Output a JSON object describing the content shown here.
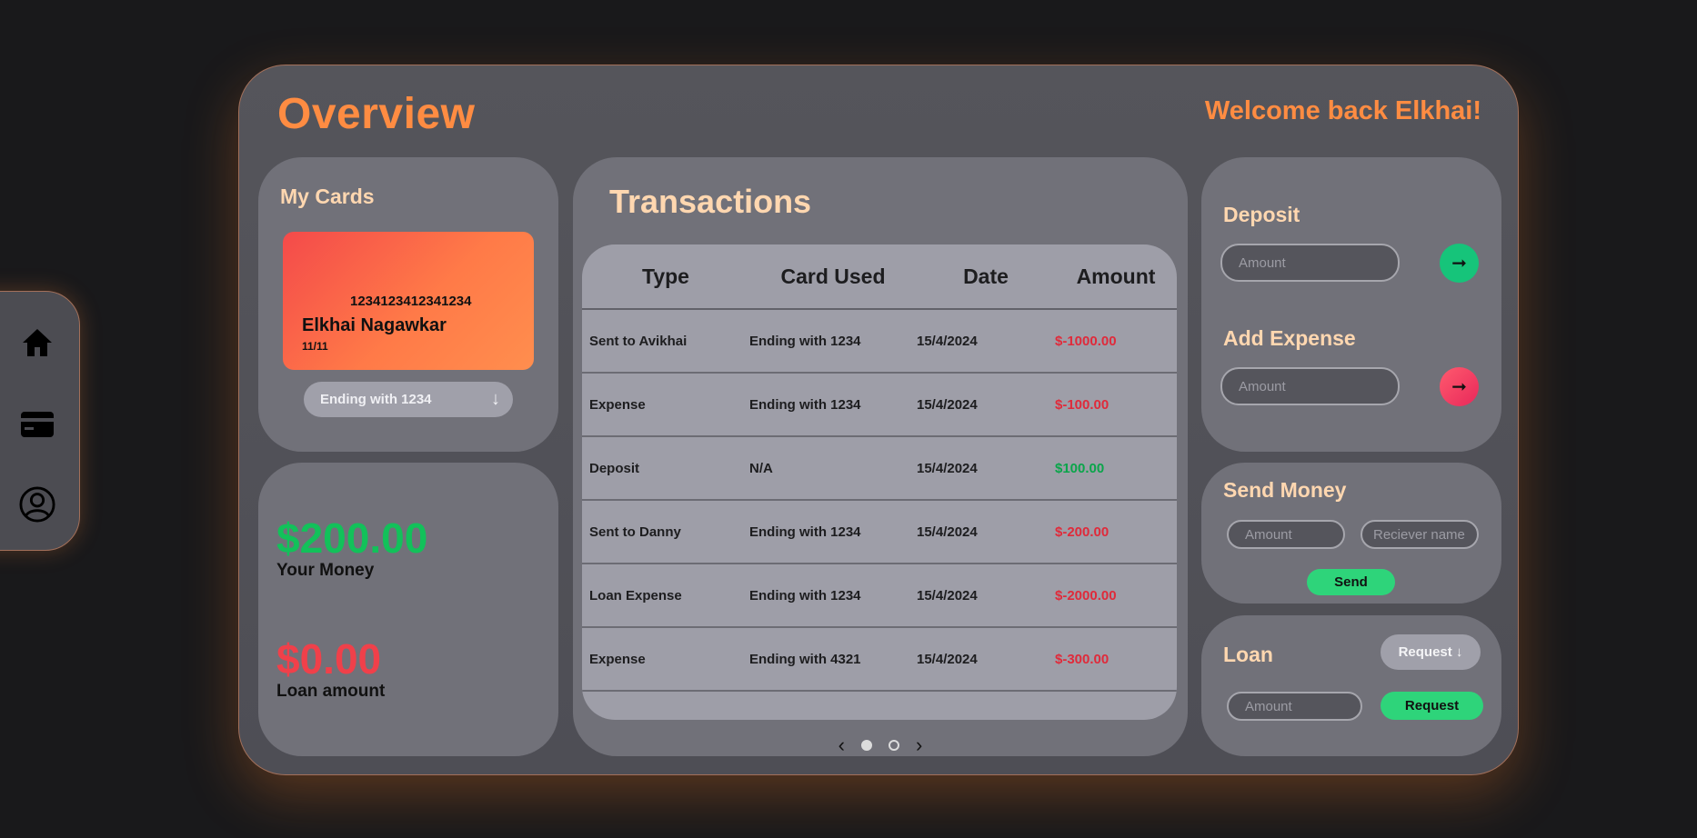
{
  "header": {
    "title": "Overview",
    "welcome": "Welcome back Elkhai!"
  },
  "sidebar": {
    "items": [
      {
        "icon": "home-icon"
      },
      {
        "icon": "credit-card-icon"
      },
      {
        "icon": "user-icon"
      }
    ]
  },
  "cards": {
    "title": "My Cards",
    "card_number": "1234123412341234",
    "holder": "Elkhai Nagawkar",
    "expiry": "11/11",
    "selected": "Ending with 1234",
    "gradient": [
      "#f44a4a",
      "#ff8e4e"
    ]
  },
  "money": {
    "balance": "$200.00",
    "balance_label": "Your Money",
    "loan": "$0.00",
    "loan_label": "Loan amount"
  },
  "transactions": {
    "title": "Transactions",
    "columns": [
      "Type",
      "Card Used",
      "Date",
      "Amount"
    ],
    "rows": [
      {
        "type": "Sent to Avikhai",
        "card": "Ending with 1234",
        "date": "15/4/2024",
        "amount": "$-1000.00",
        "color": "#e02a3a"
      },
      {
        "type": "Expense",
        "card": "Ending with 1234",
        "date": "15/4/2024",
        "amount": "$-100.00",
        "color": "#e02a3a"
      },
      {
        "type": "Deposit",
        "card": "N/A",
        "date": "15/4/2024",
        "amount": "$100.00",
        "color": "#0aa54a"
      },
      {
        "type": "Sent to Danny",
        "card": "Ending with 1234",
        "date": "15/4/2024",
        "amount": "$-200.00",
        "color": "#e02a3a"
      },
      {
        "type": "Loan Expense",
        "card": "Ending with 1234",
        "date": "15/4/2024",
        "amount": "$-2000.00",
        "color": "#e02a3a"
      },
      {
        "type": "Expense",
        "card": "Ending with 4321",
        "date": "15/4/2024",
        "amount": "$-300.00",
        "color": "#e02a3a"
      }
    ],
    "pager": {
      "pages": 2,
      "current": 1
    }
  },
  "deposit": {
    "title": "Deposit",
    "placeholder": "Amount",
    "button_color": "#16c47a"
  },
  "expense": {
    "title": "Add Expense",
    "placeholder": "Amount",
    "button_color": "#f23c64"
  },
  "send": {
    "title": "Send Money",
    "amount_placeholder": "Amount",
    "receiver_placeholder": "Reciever name",
    "button": "Send"
  },
  "loan": {
    "title": "Loan",
    "type_button": "Request ↓",
    "amount_placeholder": "Amount",
    "button": "Request"
  },
  "colors": {
    "accent": "#ff8c42",
    "positive": "#0aa54a",
    "negative": "#e02a3a",
    "green_button": "#2ed47a"
  }
}
